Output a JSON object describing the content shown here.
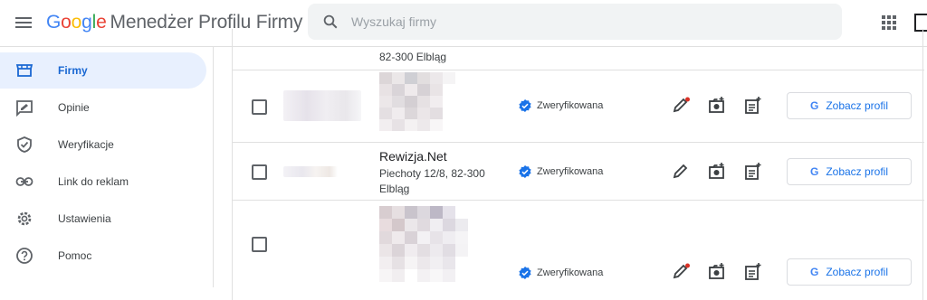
{
  "header": {
    "logo_letters": [
      "G",
      "o",
      "o",
      "g",
      "l",
      "e"
    ],
    "product_name": "Menedżer Profilu Firmy",
    "search_placeholder": "Wyszukaj firmy"
  },
  "sidebar": {
    "items": [
      {
        "label": "Firmy",
        "icon": "storefront-icon",
        "active": true
      },
      {
        "label": "Opinie",
        "icon": "review-icon",
        "active": false
      },
      {
        "label": "Weryfikacje",
        "icon": "shield-check-icon",
        "active": false
      },
      {
        "label": "Link do reklam",
        "icon": "link-icon",
        "active": false
      },
      {
        "label": "Ustawienia",
        "icon": "gear-icon",
        "active": false
      },
      {
        "label": "Pomoc",
        "icon": "help-icon",
        "active": false
      }
    ]
  },
  "listings": [
    {
      "name": "",
      "address_line1": "82-300 Elbląg",
      "address_line2": "",
      "status": "",
      "button": ""
    },
    {
      "name": "",
      "address_line1": "",
      "address_line2": "",
      "status": "Zweryfikowana",
      "button": "Zobacz profil",
      "edit_has_dot": true
    },
    {
      "name": "Rewizja.Net",
      "address_line1": "Piechoty 12/8, 82-300",
      "address_line2": "Elbląg",
      "status": "Zweryfikowana",
      "button": "Zobacz profil",
      "edit_has_dot": false
    },
    {
      "name": "",
      "address_line1": "",
      "address_line2": "",
      "status": "Zweryfikowana",
      "button": "Zobacz profil",
      "edit_has_dot": true
    }
  ],
  "colors": {
    "accent": "#1a73e8",
    "active_bg": "#e8f0fe",
    "verified": "#1a73e8",
    "dot": "#d93025"
  }
}
